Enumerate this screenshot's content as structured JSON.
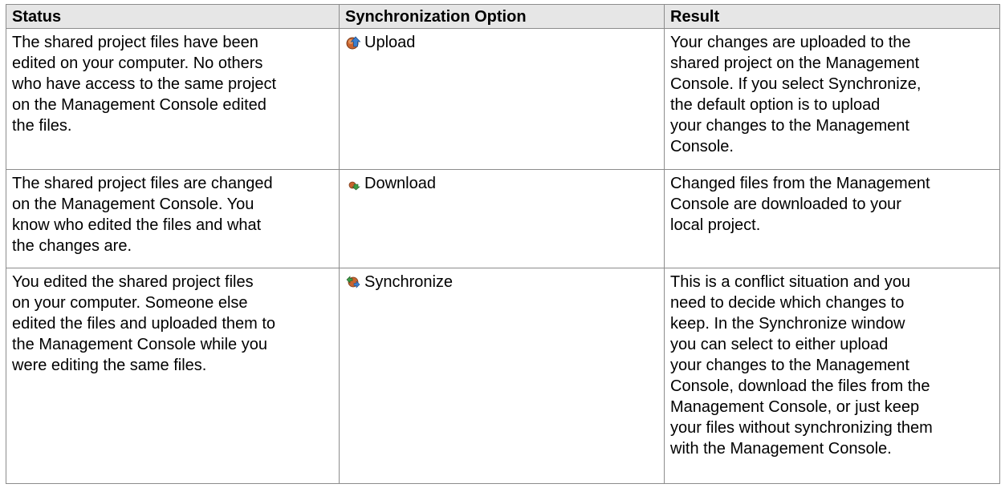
{
  "table": {
    "headers": {
      "status": "Status",
      "option": "Synchronization Option",
      "result": "Result"
    },
    "rows": [
      {
        "status": "The shared project files have been\nedited on your computer. No others\nwho have access to the same project\non the Management Console edited\nthe files.",
        "option_icon": "upload-icon",
        "option_label": "Upload",
        "result": "Your changes are uploaded to the\nshared project on the Management\nConsole. If you select Synchronize,\nthe default option is to upload\nyour changes to the Management\nConsole."
      },
      {
        "status": "The shared project files are changed\non the Management Console. You\nknow who edited the files and what\nthe changes are.",
        "option_icon": "download-icon",
        "option_label": "Download",
        "result": "Changed files from the Management\nConsole are downloaded to your\nlocal project."
      },
      {
        "status": "You edited the shared project files\non your computer. Someone else\nedited the files and uploaded them to\nthe Management Console while you\nwere editing the same files.",
        "option_icon": "synchronize-icon",
        "option_label": "Synchronize",
        "result": "This is a conflict situation and you\nneed to decide which changes to\nkeep. In the Synchronize window\nyou can select to either upload\nyour changes to the Management\nConsole, download the files from the\nManagement Console, or just keep\nyour files without synchronizing them\nwith the Management Console."
      }
    ]
  }
}
